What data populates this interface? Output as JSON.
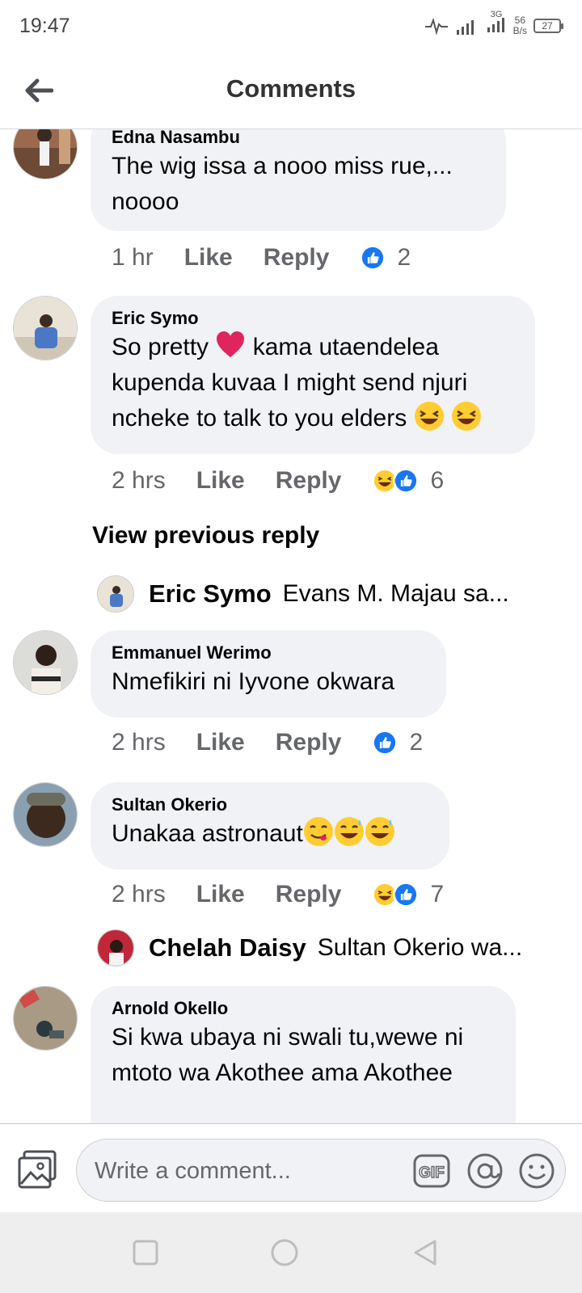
{
  "status": {
    "time": "19:47",
    "net_speed_value": "56",
    "net_speed_unit": "B/s",
    "network": "3G",
    "battery": "27"
  },
  "header": {
    "title": "Comments"
  },
  "comments": [
    {
      "author": "Edna Nasambu",
      "text": "The wig issa a nooo miss rue,... noooo",
      "time": "1 hr",
      "like": "Like",
      "reply": "Reply",
      "reaction_count": "2",
      "reactions": [
        "like"
      ]
    },
    {
      "author": "Eric Symo",
      "text": "So pretty",
      "text_2": "kama utaendelea kupenda kuvaa I might send njuri ncheke to talk to you elders",
      "time": "2 hrs",
      "like": "Like",
      "reply": "Reply",
      "reaction_count": "6",
      "reactions": [
        "haha",
        "like"
      ]
    },
    {
      "author": "Emmanuel Werimo",
      "text": "Nmefikiri ni Iyvone okwara",
      "time": "2 hrs",
      "like": "Like",
      "reply": "Reply",
      "reaction_count": "2",
      "reactions": [
        "like"
      ]
    },
    {
      "author": "Sultan Okerio",
      "text": "Unakaa astronaut",
      "time": "2 hrs",
      "like": "Like",
      "reply": "Reply",
      "reaction_count": "7",
      "reactions": [
        "haha",
        "like"
      ]
    },
    {
      "author": "Arnold Okello",
      "text": "Si kwa ubaya ni swali tu,wewe ni mtoto wa Akothee ama Akothee"
    }
  ],
  "view_previous_reply": "View previous reply",
  "replies": [
    {
      "author": "Eric Symo",
      "text": "Evans M. Majau sa..."
    },
    {
      "author": "Chelah Daisy",
      "text": "Sultan Okerio wa..."
    }
  ],
  "composer": {
    "placeholder": "Write a comment...",
    "gif_label": "GIF"
  },
  "colors": {
    "like_blue": "#1877f2",
    "bubble_bg": "#f0f2f5",
    "meta_gray": "#65676b",
    "heart_red": "#e0245e",
    "emoji_yellow": "#ffcc33"
  },
  "icons": [
    "back-arrow-icon",
    "photo-icon",
    "gif-icon",
    "at-icon",
    "emoji-icon",
    "like-reaction-icon",
    "haha-reaction-icon",
    "heart-emoji",
    "laughing-emoji",
    "sweat-smile-emoji",
    "yum-emoji",
    "square-nav-icon",
    "circle-nav-icon",
    "triangle-nav-icon"
  ]
}
